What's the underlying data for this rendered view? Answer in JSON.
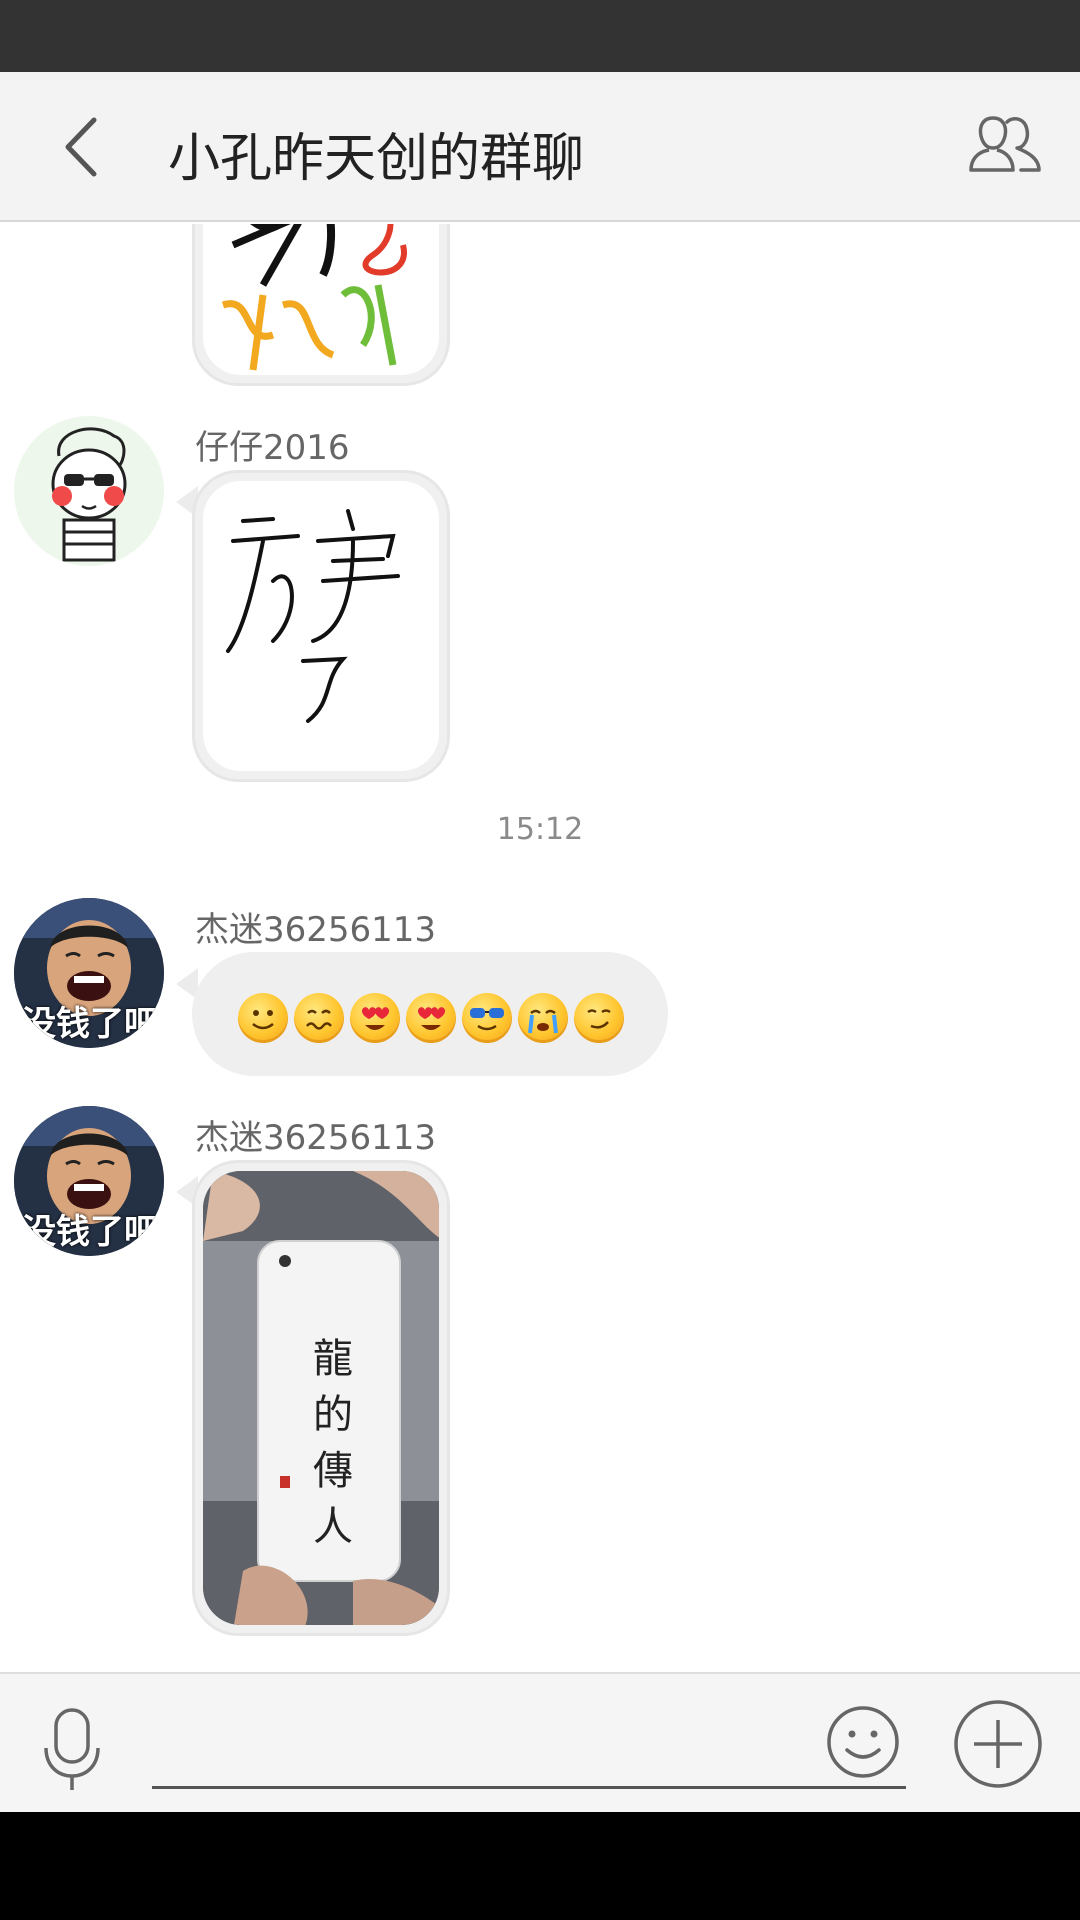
{
  "header": {
    "title": "小孔昨天创的群聊",
    "back_icon": "chevron-left-icon",
    "members_icon": "group-members-icon"
  },
  "messages": [
    {
      "type": "image",
      "sender": "",
      "image_desc": "handwritten-doodle-image"
    },
    {
      "type": "image",
      "sender": "仔仔2016",
      "avatar": "cartoon-sunglasses-boy-avatar",
      "image_desc": "handwritten-characters-image"
    },
    {
      "type": "timestamp",
      "text": "15:12"
    },
    {
      "type": "emoji",
      "sender": "杰迷36256113",
      "avatar": "laughing-man-avatar",
      "avatar_caption": "没钱了吧",
      "emojis": [
        "smile",
        "wavy-mouth",
        "heart-eyes",
        "heart-eyes",
        "cool-sunglasses",
        "crying",
        "smirk"
      ]
    },
    {
      "type": "image",
      "sender": "杰迷36256113",
      "avatar": "laughing-man-avatar",
      "avatar_caption": "没钱了吧",
      "image_desc": "white-phone-calligraphy-photo",
      "photo_text": [
        "龍",
        "的",
        "傳",
        "人"
      ]
    }
  ],
  "input_bar": {
    "mic_icon": "microphone-icon",
    "emoji_icon": "smiley-face-icon",
    "plus_icon": "plus-circle-icon",
    "value": ""
  },
  "colors": {
    "status_bar": "#333333",
    "title_bar": "#f3f3f3",
    "bubble": "#f0f0f0"
  }
}
